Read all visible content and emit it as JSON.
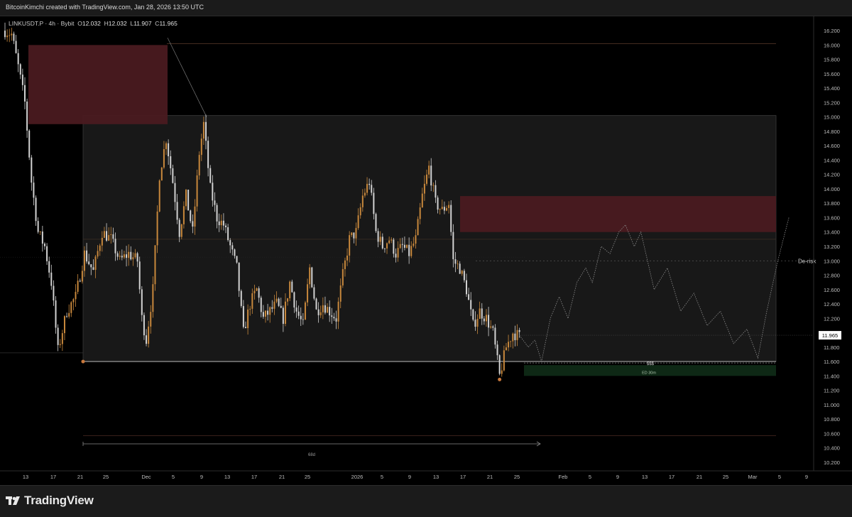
{
  "header": {
    "credit": "BitcoinKimchi created with TradingView.com, Jan 28, 2026 13:50 UTC"
  },
  "legend": {
    "symbol": "LINKUSDT.P",
    "interval": "4h",
    "exchange": "Bybit",
    "open_label": "O",
    "open": "12.032",
    "high_label": "H",
    "high": "12.032",
    "low_label": "L",
    "low": "11.907",
    "close_label": "C",
    "close": "11.965"
  },
  "colors": {
    "background": "#000000",
    "candle_up": "#c8883c",
    "candle_down": "#d2d2d2",
    "supply_zone": "#4a1a20",
    "demand_zone": "#0f2a16",
    "range_box": "#181818",
    "price_tag": "#ffffff"
  },
  "chart_data": {
    "type": "candlestick",
    "y_axis": {
      "ylim": [
        10.1,
        16.3
      ],
      "ticks": [
        "16.200",
        "16.000",
        "15.800",
        "15.600",
        "15.400",
        "15.200",
        "15.000",
        "14.800",
        "14.600",
        "14.400",
        "14.200",
        "14.000",
        "13.800",
        "13.600",
        "13.400",
        "13.200",
        "13.000",
        "12.800",
        "12.600",
        "12.400",
        "12.200",
        "12.000",
        "11.800",
        "11.600",
        "11.400",
        "11.200",
        "11.000",
        "10.800",
        "10.600",
        "10.400",
        "10.200"
      ]
    },
    "x_axis": {
      "ticks": [
        "13",
        "17",
        "21",
        "25",
        "Dec",
        "5",
        "9",
        "13",
        "17",
        "21",
        "25",
        "2026",
        "5",
        "9",
        "13",
        "17",
        "21",
        "25",
        "Feb",
        "5",
        "9",
        "13",
        "17",
        "21",
        "25",
        "Mar",
        "5",
        "9"
      ]
    },
    "last_price": 11.965,
    "candle_path": [
      [
        0,
        16.2
      ],
      [
        3,
        16.15
      ],
      [
        6,
        15.7
      ],
      [
        9,
        15.2
      ],
      [
        12,
        14.1
      ],
      [
        15,
        13.4
      ],
      [
        18,
        13.2
      ],
      [
        21,
        12.7
      ],
      [
        24,
        11.75
      ],
      [
        28,
        12.3
      ],
      [
        32,
        12.5
      ],
      [
        36,
        13.1
      ],
      [
        40,
        12.85
      ],
      [
        44,
        13.4
      ],
      [
        48,
        13.3
      ],
      [
        52,
        13.0
      ],
      [
        56,
        13.1
      ],
      [
        60,
        13.0
      ],
      [
        62,
        12.2
      ],
      [
        64,
        11.9
      ],
      [
        67,
        12.6
      ],
      [
        70,
        14.2
      ],
      [
        73,
        14.7
      ],
      [
        76,
        14.1
      ],
      [
        79,
        13.4
      ],
      [
        82,
        13.9
      ],
      [
        85,
        13.4
      ],
      [
        88,
        14.5
      ],
      [
        90,
        14.9
      ],
      [
        93,
        14.0
      ],
      [
        96,
        13.6
      ],
      [
        99,
        13.5
      ],
      [
        102,
        13.2
      ],
      [
        105,
        12.9
      ],
      [
        108,
        12.0
      ],
      [
        111,
        12.4
      ],
      [
        114,
        12.6
      ],
      [
        117,
        12.2
      ],
      [
        120,
        12.3
      ],
      [
        123,
        12.4
      ],
      [
        126,
        12.2
      ],
      [
        129,
        12.7
      ],
      [
        132,
        12.3
      ],
      [
        135,
        12.1
      ],
      [
        138,
        12.9
      ],
      [
        141,
        12.3
      ],
      [
        144,
        12.4
      ],
      [
        147,
        12.3
      ],
      [
        150,
        12.2
      ],
      [
        153,
        12.8
      ],
      [
        156,
        13.3
      ],
      [
        159,
        13.4
      ],
      [
        162,
        13.9
      ],
      [
        165,
        14.1
      ],
      [
        168,
        13.4
      ],
      [
        171,
        13.2
      ],
      [
        174,
        13.3
      ],
      [
        177,
        13.1
      ],
      [
        180,
        13.2
      ],
      [
        183,
        13.1
      ],
      [
        186,
        13.3
      ],
      [
        189,
        13.9
      ],
      [
        192,
        14.3
      ],
      [
        195,
        13.8
      ],
      [
        198,
        13.7
      ],
      [
        201,
        13.8
      ],
      [
        203,
        13.0
      ],
      [
        206,
        12.9
      ],
      [
        209,
        12.6
      ],
      [
        212,
        12.1
      ],
      [
        215,
        12.3
      ],
      [
        218,
        12.2
      ],
      [
        221,
        12.0
      ],
      [
        224,
        11.4
      ],
      [
        227,
        11.8
      ],
      [
        230,
        12.0
      ],
      [
        233,
        11.95
      ]
    ],
    "projection_path": [
      [
        233,
        11.965
      ],
      [
        237,
        11.8
      ],
      [
        240,
        11.9
      ],
      [
        243,
        11.6
      ],
      [
        247,
        12.2
      ],
      [
        251,
        12.5
      ],
      [
        255,
        12.2
      ],
      [
        259,
        12.7
      ],
      [
        263,
        12.9
      ],
      [
        266,
        12.7
      ],
      [
        270,
        13.2
      ],
      [
        274,
        13.1
      ],
      [
        278,
        13.4
      ],
      [
        281,
        13.5
      ],
      [
        285,
        13.2
      ],
      [
        288,
        13.4
      ],
      [
        294,
        12.6
      ],
      [
        300,
        12.9
      ],
      [
        306,
        12.3
      ],
      [
        312,
        12.55
      ],
      [
        318,
        12.1
      ],
      [
        324,
        12.3
      ],
      [
        330,
        11.85
      ],
      [
        336,
        12.05
      ],
      [
        341,
        11.65
      ],
      [
        345,
        12.3
      ],
      [
        350,
        13.0
      ],
      [
        355,
        13.6
      ]
    ],
    "zones": [
      {
        "name": "supply-zone-top",
        "y_top": 16.0,
        "y_bottom": 14.9
      },
      {
        "name": "supply-zone-mid",
        "y_top": 13.9,
        "y_bottom": 13.4
      },
      {
        "name": "demand-zone-ed",
        "y_top": 11.55,
        "y_bottom": 11.4
      }
    ],
    "range_box": {
      "y_top": 15.02,
      "y_bottom": 11.6
    },
    "levels": {
      "top_line": 16.02,
      "mid_line": 13.3,
      "derisk_line": 13.0,
      "lower_line": 11.72,
      "sss_line": 11.58,
      "bottom_line": 10.57
    },
    "annotations": {
      "derisk": "De-risk",
      "sss": "$$$",
      "ed": "ED 30m",
      "duration": "68d",
      "last_price_tag": "11.965"
    }
  },
  "footer": {
    "brand": "TradingView"
  }
}
